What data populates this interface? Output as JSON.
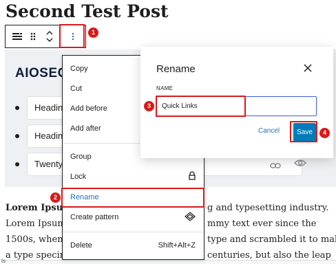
{
  "post": {
    "title": "Second Test Post"
  },
  "toolbar": {
    "icons": [
      "block-icon",
      "drag-handle-icon",
      "move-up-down-icon",
      "more-options-icon"
    ]
  },
  "aioseo": {
    "heading": "AIOSEO",
    "links": [
      "Heading",
      "Heading",
      "Twenty"
    ]
  },
  "body_text": {
    "lines": [
      {
        "bold": "Lorem Ipsum",
        "left": "",
        "right": "g and typesetting industry."
      },
      {
        "bold": "",
        "left": "Lorem Ipsum l",
        "right": "mmy text ever since the"
      },
      {
        "bold": "",
        "left": "1500s, when a",
        "right": "type and scrambled it to make"
      },
      {
        "bold": "",
        "left": "a type specime",
        "right": "centuries, but also the leap"
      }
    ],
    "status_fragment": "ts"
  },
  "menu": {
    "items": [
      {
        "label": "Copy",
        "shortcut": ""
      },
      {
        "label": "Cut",
        "shortcut": ""
      },
      {
        "label": "Add before",
        "shortcut": ""
      },
      {
        "label": "Add after",
        "shortcut": ""
      },
      {
        "label": "Group",
        "shortcut": ""
      },
      {
        "label": "Lock",
        "shortcut": ""
      },
      {
        "label": "Rename",
        "shortcut": ""
      },
      {
        "label": "Create pattern",
        "shortcut": ""
      },
      {
        "label": "Delete",
        "shortcut": "Shift+Alt+Z"
      }
    ],
    "highlight_color": "#2271b1"
  },
  "modal": {
    "title": "Rename",
    "field_label": "NAME",
    "input_value": "Quick Links",
    "cancel_label": "Cancel",
    "save_label": "Save"
  },
  "annotations": [
    "1",
    "2",
    "3",
    "4"
  ],
  "colors": {
    "annotation_red": "#d91919",
    "primary_blue": "#007cba",
    "focus_blue": "#3858e9"
  }
}
